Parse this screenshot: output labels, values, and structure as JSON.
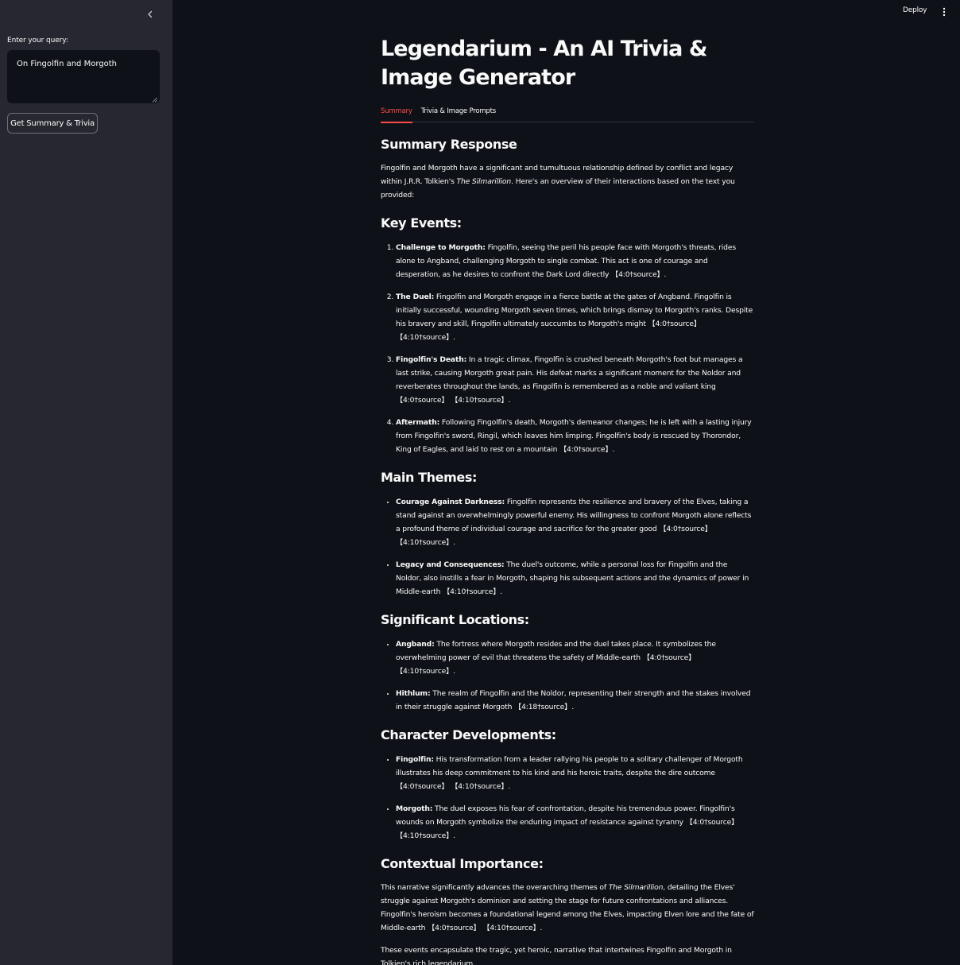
{
  "sidebar": {
    "collapse_icon": "chevron-left-icon",
    "query_label": "Enter your query:",
    "query_value": "On Fingolfin and Morgoth",
    "submit_label": "Get Summary & Trivia"
  },
  "header": {
    "deploy_label": "Deploy",
    "menu_icon": "vertical-dots-icon"
  },
  "main": {
    "title": "Legendarium - An AI Trivia & Image Generator",
    "tabs": [
      {
        "label": "Summary",
        "active": true
      },
      {
        "label": "Trivia & Image Prompts",
        "active": false
      }
    ],
    "summary_heading": "Summary Response",
    "intro": {
      "before": "Fingolfin and Morgoth have a significant and tumultuous relationship defined by conflict and legacy within J.R.R. Tolkien's ",
      "italic": "The Silmarillion",
      "after": ". Here's an overview of their interactions based on the text you provided:"
    },
    "key_events_heading": "Key Events:",
    "key_events": [
      {
        "term": "Challenge to Morgoth:",
        "text": " Fingolfin, seeing the peril his people face with Morgoth's threats, rides alone to Angband, challenging Morgoth to single combat. This act is one of courage and desperation, as he desires to confront the Dark Lord directly 【4:0†source】."
      },
      {
        "term": "The Duel:",
        "text": " Fingolfin and Morgoth engage in a fierce battle at the gates of Angband. Fingolfin is initially successful, wounding Morgoth seven times, which brings dismay to Morgoth's ranks. Despite his bravery and skill, Fingolfin ultimately succumbs to Morgoth's might 【4:0†source】 【4:10†source】."
      },
      {
        "term": "Fingolfin's Death:",
        "text": " In a tragic climax, Fingolfin is crushed beneath Morgoth's foot but manages a last strike, causing Morgoth great pain. His defeat marks a significant moment for the Noldor and reverberates throughout the lands, as Fingolfin is remembered as a noble and valiant king 【4:0†source】 【4:10†source】."
      },
      {
        "term": "Aftermath:",
        "text": " Following Fingolfin's death, Morgoth's demeanor changes; he is left with a lasting injury from Fingolfin's sword, Ringil, which leaves him limping. Fingolfin's body is rescued by Thorondor, King of Eagles, and laid to rest on a mountain 【4:0†source】."
      }
    ],
    "themes_heading": "Main Themes:",
    "themes": [
      {
        "term": "Courage Against Darkness:",
        "text": " Fingolfin represents the resilience and bravery of the Elves, taking a stand against an overwhelmingly powerful enemy. His willingness to confront Morgoth alone reflects a profound theme of individual courage and sacrifice for the greater good 【4:0†source】 【4:10†source】."
      },
      {
        "term": "Legacy and Consequences:",
        "text": " The duel's outcome, while a personal loss for Fingolfin and the Noldor, also instills a fear in Morgoth, shaping his subsequent actions and the dynamics of power in Middle-earth 【4:10†source】."
      }
    ],
    "locations_heading": "Significant Locations:",
    "locations": [
      {
        "term": "Angband:",
        "text": " The fortress where Morgoth resides and the duel takes place. It symbolizes the overwhelming power of evil that threatens the safety of Middle-earth 【4:0†source】 【4:10†source】."
      },
      {
        "term": "Hithlum:",
        "text": " The realm of Fingolfin and the Noldor, representing their strength and the stakes involved in their struggle against Morgoth 【4:18†source】."
      }
    ],
    "characters_heading": "Character Developments:",
    "characters": [
      {
        "term": "Fingolfin:",
        "text": " His transformation from a leader rallying his people to a solitary challenger of Morgoth illustrates his deep commitment to his kind and his heroic traits, despite the dire outcome 【4:0†source】 【4:10†source】."
      },
      {
        "term": "Morgoth:",
        "text": " The duel exposes his fear of confrontation, despite his tremendous power. Fingolfin's wounds on Morgoth symbolize the enduring impact of resistance against tyranny 【4:0†source】 【4:10†source】."
      }
    ],
    "context_heading": "Contextual Importance:",
    "context": {
      "before": "This narrative significantly advances the overarching themes of ",
      "italic": "The Silmarillion",
      "after": ", detailing the Elves' struggle against Morgoth's dominion and setting the stage for future confrontations and alliances. Fingolfin's heroism becomes a foundational legend among the Elves, impacting Elven lore and the fate of Middle-earth 【4:0†source】 【4:10†source】."
    },
    "closing": "These events encapsulate the tragic, yet heroic, narrative that intertwines Fingolfin and Morgoth in Tolkien's rich legendarium."
  }
}
